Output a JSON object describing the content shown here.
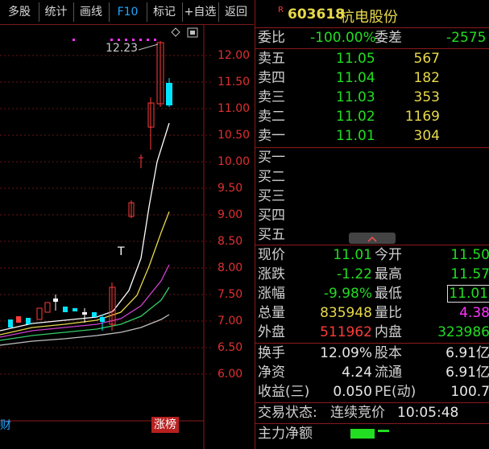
{
  "toolbar": {
    "buttons": [
      "多股",
      "统计",
      "画线",
      "F10",
      "标记",
      "+自选",
      "返回"
    ]
  },
  "chart": {
    "price_ticks": [
      "12.00",
      "11.50",
      "11.00",
      "10.50",
      "10.00",
      "9.50",
      "9.00",
      "8.50",
      "8.00",
      "7.50",
      "7.00",
      "6.50",
      "6.00"
    ],
    "high_label": "12.23",
    "marker_T": "T",
    "bottom_left_label": "财",
    "bottom_right_badge": "涨榜"
  },
  "quote": {
    "badge": "R",
    "code": "603618",
    "name": "杭电股份",
    "weibi_label": "委比",
    "weibi_value": "-100.00%",
    "weicha_label": "委差",
    "weicha_value": "-2575",
    "asks": [
      {
        "label": "卖五",
        "price": "11.05",
        "volume": "567"
      },
      {
        "label": "卖四",
        "price": "11.04",
        "volume": "182"
      },
      {
        "label": "卖三",
        "price": "11.03",
        "volume": "353"
      },
      {
        "label": "卖二",
        "price": "11.02",
        "volume": "1169"
      },
      {
        "label": "卖一",
        "price": "11.01",
        "volume": "304"
      }
    ],
    "bids": [
      {
        "label": "买一"
      },
      {
        "label": "买二"
      },
      {
        "label": "买三"
      },
      {
        "label": "买四"
      },
      {
        "label": "买五"
      }
    ],
    "stats": [
      {
        "l1": "现价",
        "v1": "11.01",
        "l2": "今开",
        "v2": "11.50"
      },
      {
        "l1": "涨跌",
        "v1": "-1.22",
        "l2": "最高",
        "v2": "11.57"
      },
      {
        "l1": "涨幅",
        "v1": "-9.98%",
        "l2": "最低",
        "v2": "11.01"
      },
      {
        "l1": "总量",
        "v1": "835948",
        "l2": "量比",
        "v2": "4.38"
      },
      {
        "l1": "外盘",
        "v1": "511962",
        "l2": "内盘",
        "v2": "323986"
      }
    ],
    "fundamentals": [
      {
        "l1": "换手",
        "v1": "12.09%",
        "l2": "股本",
        "v2": "6.91亿"
      },
      {
        "l1": "净资",
        "v1": "4.24",
        "l2": "流通",
        "v2": "6.91亿"
      },
      {
        "l1": "收益(三)",
        "v1": "0.050",
        "l2": "PE(动)",
        "v2": "100.7"
      }
    ],
    "status_label": "交易状态:",
    "status_value": "连续竞价",
    "time": "10:05:48",
    "netflow_label": "主力净额"
  }
}
